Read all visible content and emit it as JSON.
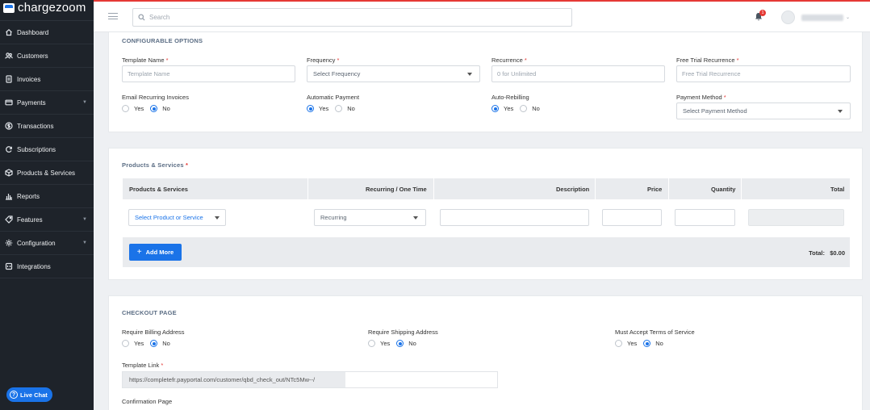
{
  "brand": {
    "name": "chargezoom",
    "accent": "#1a73e8"
  },
  "sidebar": {
    "items": [
      {
        "label": "Dashboard",
        "icon": "home-icon",
        "has_caret": false
      },
      {
        "label": "Customers",
        "icon": "users-icon",
        "has_caret": false
      },
      {
        "label": "Invoices",
        "icon": "invoice-icon",
        "has_caret": false
      },
      {
        "label": "Payments",
        "icon": "card-icon",
        "has_caret": true
      },
      {
        "label": "Transactions",
        "icon": "dollar-icon",
        "has_caret": false
      },
      {
        "label": "Subscriptions",
        "icon": "refresh-icon",
        "has_caret": false
      },
      {
        "label": "Products & Services",
        "icon": "box-icon",
        "has_caret": false
      },
      {
        "label": "Reports",
        "icon": "bar-chart-icon",
        "has_caret": false
      },
      {
        "label": "Features",
        "icon": "tag-icon",
        "has_caret": true
      },
      {
        "label": "Configuration",
        "icon": "gear-icon",
        "has_caret": true
      },
      {
        "label": "Integrations",
        "icon": "plug-icon",
        "has_caret": false
      }
    ],
    "live_chat": "Live Chat"
  },
  "topbar": {
    "search_placeholder": "Search",
    "notification_count": "1"
  },
  "configurable": {
    "title": "CONFIGURABLE OPTIONS",
    "template_name": {
      "label": "Template Name",
      "placeholder": "Template Name"
    },
    "frequency": {
      "label": "Frequency",
      "value": "Select Frequency"
    },
    "recurrence": {
      "label": "Recurrence",
      "placeholder": "0 for Unlimited"
    },
    "free_trial": {
      "label": "Free Trial Recurrence",
      "placeholder": "Free Trial Recurrence"
    },
    "email_recurring": {
      "label": "Email Recurring Invoices",
      "yes": "Yes",
      "no": "No",
      "selected": "no"
    },
    "automatic_payment": {
      "label": "Automatic Payment",
      "yes": "Yes",
      "no": "No",
      "selected": "yes"
    },
    "auto_rebilling": {
      "label": "Auto-Rebilling",
      "yes": "Yes",
      "no": "No",
      "selected": "yes"
    },
    "payment_method": {
      "label": "Payment Method",
      "value": "Select Payment Method"
    }
  },
  "products": {
    "title": "Products & Services",
    "columns": [
      "Products & Services",
      "Recurring / One Time",
      "Description",
      "Price",
      "Quantity",
      "Total"
    ],
    "row": {
      "product_select": "Select Product or Service",
      "recurring_select": "Recurring"
    },
    "add_more": "Add More",
    "total_label": "Total:",
    "total_value": "$0.00"
  },
  "checkout": {
    "title": "CHECKOUT PAGE",
    "billing": {
      "label": "Require Billing Address",
      "yes": "Yes",
      "no": "No",
      "selected": "no"
    },
    "shipping": {
      "label": "Require Shipping Address",
      "yes": "Yes",
      "no": "No",
      "selected": "no"
    },
    "terms": {
      "label": "Must Accept Terms of Service",
      "yes": "Yes",
      "no": "No",
      "selected": "no"
    },
    "template_link": {
      "label": "Template Link",
      "value": "https://completefr.payportal.com/customer/qbd_check_out/NTc5Mw--/"
    },
    "confirmation_page": {
      "label": "Confirmation Page"
    }
  }
}
